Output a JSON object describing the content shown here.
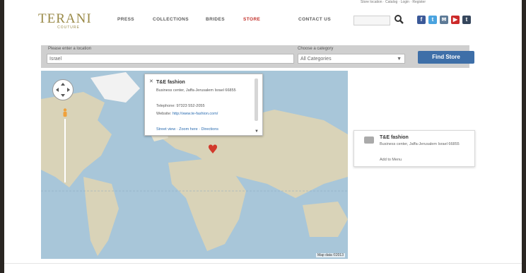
{
  "header": {
    "logo": {
      "brand": "TERANI",
      "sub": "COUTURE"
    },
    "topright_text": "Store location · Catalog · Login · Register",
    "nav": [
      "PRESS",
      "COLLECTIONS",
      "BRIDES",
      "STORE"
    ]
  },
  "colors": {
    "accent": "#c2302a",
    "button": "#3e6fa8",
    "brand": "#9a8a48",
    "map_water": "#a8c6d9",
    "map_land": "#d9d3b8"
  },
  "filter": {
    "location_label": "Please enter a location",
    "location_value": "Israel",
    "category_label": "Choose a category",
    "category_value": "All Categories",
    "find_label": "Find Store"
  },
  "map": {
    "info": {
      "title": "T&E fashion",
      "address": "Business center, Jaffa-Jerusalem Israel 66855",
      "phone": "Telephone: 97323 552-2055",
      "website_label": "Website:",
      "website_value": "http://www.te-fashion.com/",
      "links": "Street view · Zoom here · Directions"
    },
    "credit": "Map data ©2013"
  },
  "result": {
    "name": "T&E fashion",
    "address": "Business center, Jaffa-Jerusalem Israel 66855",
    "more": "Add to Menu"
  },
  "icons": [
    "search-icon",
    "facebook-icon",
    "twitter-icon",
    "email-icon",
    "youtube-icon",
    "tumblr-icon",
    "map-marker-icon",
    "pan-control-icon",
    "pegman-icon"
  ]
}
